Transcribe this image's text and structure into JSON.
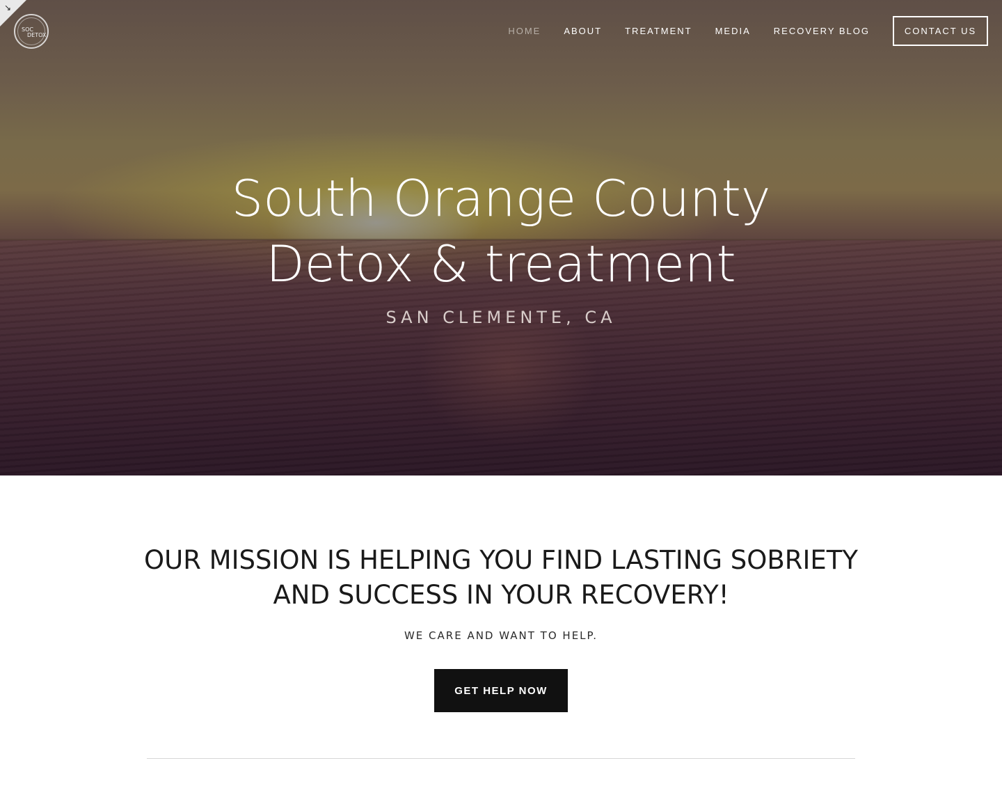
{
  "corner": {
    "icon": "↘"
  },
  "logo": {
    "line1": "SOC",
    "line2": "DETOX"
  },
  "nav": {
    "items": [
      {
        "label": "HOME",
        "active": true
      },
      {
        "label": "ABOUT",
        "active": false
      },
      {
        "label": "TREATMENT",
        "active": false
      },
      {
        "label": "MEDIA",
        "active": false
      },
      {
        "label": "RECOVERY BLOG",
        "active": false
      }
    ],
    "contact_label": "CONTACT US"
  },
  "hero": {
    "title_line1": "South Orange County",
    "title_line2": "Detox & treatment",
    "subtitle": "SAN CLEMENTE, CA"
  },
  "mission": {
    "title_line1": "OUR MISSION IS HELPING YOU FIND LASTING SOBRIETY",
    "title_line2": "AND SUCCESS IN YOUR RECOVERY!",
    "subtitle": "WE CARE AND WANT TO HELP.",
    "cta_label": "GET HELP NOW"
  },
  "colors": {
    "nav_active": "#b8b0a8",
    "cta_background": "#111111",
    "divider": "#d7d7d7"
  }
}
